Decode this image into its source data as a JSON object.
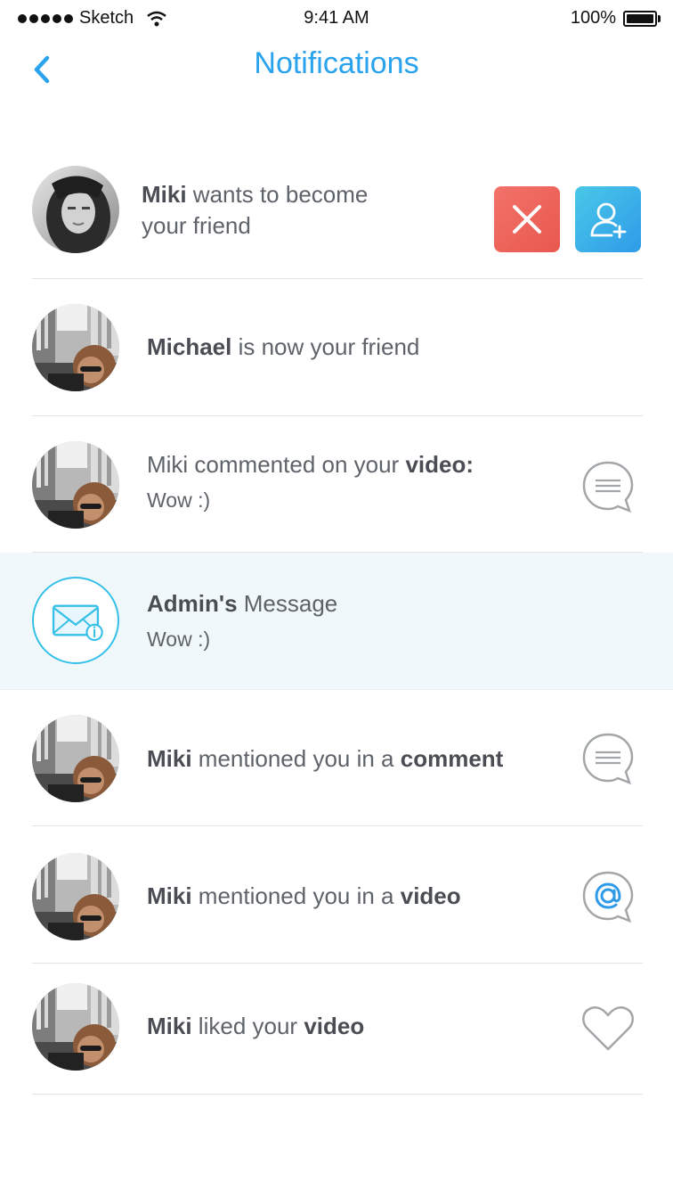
{
  "status_bar": {
    "carrier": "Sketch",
    "time": "9:41 AM",
    "battery": "100%"
  },
  "header": {
    "title": "Notifications",
    "back_icon": "chevron-left-icon"
  },
  "colors": {
    "accent": "#2aa3ee",
    "reject": "#ee6459",
    "accept": "#3aaeea",
    "highlight_bg": "#f0f8fc"
  },
  "notifications": [
    {
      "type": "friend_request",
      "name": "Miki",
      "text": " wants to become",
      "text2": "your friend",
      "actions": [
        "close-icon",
        "add-user-icon"
      ]
    },
    {
      "type": "friend_accepted",
      "name": "Michael",
      "text": " is now your friend"
    },
    {
      "type": "comment",
      "prefix": "Miki commented on your ",
      "object": "video:",
      "message": "Wow :)",
      "icon": "comment-icon"
    },
    {
      "type": "admin_message",
      "name": "Admin's",
      "text": " Message",
      "message": "Wow :)",
      "avatar_icon": "mail-info-icon"
    },
    {
      "type": "mention_comment",
      "name": "Miki",
      "text": " mentioned you in a ",
      "object": "comment",
      "icon": "comment-icon"
    },
    {
      "type": "mention_video",
      "name": "Miki",
      "text": " mentioned you in a ",
      "object": "video",
      "icon": "at-icon"
    },
    {
      "type": "like",
      "name": "Miki",
      "text": " liked your ",
      "object": "video",
      "icon": "heart-icon"
    }
  ]
}
